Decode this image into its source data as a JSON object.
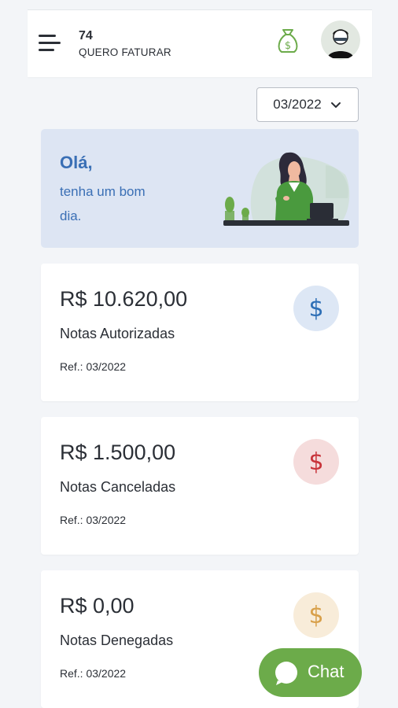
{
  "header": {
    "company_number": "74",
    "company_name": "QUERO FATURAR",
    "menu_icon": "hamburger-menu-icon",
    "money_icon": "money-bag-icon",
    "avatar_icon": "user-avatar"
  },
  "period": {
    "selected": "03/2022"
  },
  "greeting": {
    "title": "Olá,",
    "line1": "tenha um bom",
    "line2": "dia."
  },
  "cards": [
    {
      "amount": "R$ 10.620,00",
      "label": "Notas Autorizadas",
      "ref": "Ref.: 03/2022",
      "icon": "$",
      "icon_color": "#2e6fb6",
      "icon_bg": "#dde7f5"
    },
    {
      "amount": "R$ 1.500,00",
      "label": "Notas Canceladas",
      "ref": "Ref.: 03/2022",
      "icon": "$",
      "icon_color": "#c8333a",
      "icon_bg": "#f5dcdc"
    },
    {
      "amount": "R$ 0,00",
      "label": "Notas Denegadas",
      "ref": "Ref.: 03/2022",
      "icon": "$",
      "icon_color": "#d8a04a",
      "icon_bg": "#f8ecd9"
    }
  ],
  "chat": {
    "label": "Chat",
    "color": "#6cab4a"
  },
  "colors": {
    "accent_blue": "#3a6fb5",
    "green": "#6cab4a",
    "background": "#f3f5f8"
  }
}
